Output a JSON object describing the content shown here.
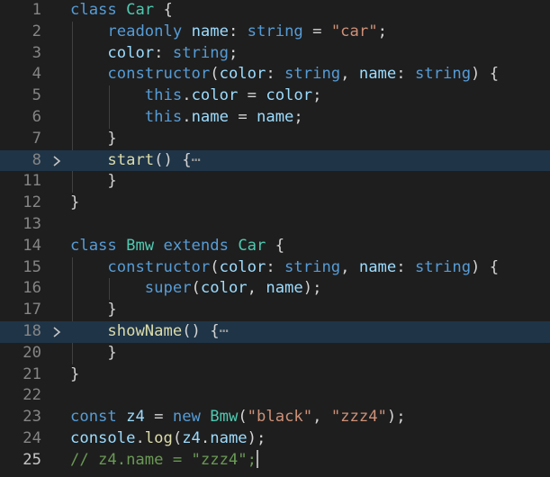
{
  "editor": {
    "colors": {
      "background": "#1e1e1e",
      "folded_line_highlight": "#1f3447",
      "line_number": "#858585",
      "active_line_number": "#c6c6c6",
      "keyword": "#569cd6",
      "function": "#dcdcaa",
      "type": "#4ec9b0",
      "variable": "#9cdcfe",
      "string": "#ce9178",
      "comment": "#6a9955",
      "plain": "#d4d4d4"
    },
    "active_line": "25",
    "fold_marker_icon": "chevron-right-icon",
    "collapsed_ellipsis": "⋯",
    "lines": [
      {
        "number": "1",
        "folded": false,
        "tokens": [
          {
            "text": "class",
            "type": "kw"
          },
          {
            "text": " ",
            "type": "pl"
          },
          {
            "text": "Car",
            "type": "ty"
          },
          {
            "text": " {",
            "type": "pl"
          }
        ]
      },
      {
        "number": "2",
        "folded": false,
        "tokens": [
          {
            "text": "    ",
            "type": "pl"
          },
          {
            "text": "readonly",
            "type": "kw"
          },
          {
            "text": " ",
            "type": "pl"
          },
          {
            "text": "name",
            "type": "var"
          },
          {
            "text": ": ",
            "type": "pl"
          },
          {
            "text": "string",
            "type": "kw"
          },
          {
            "text": " = ",
            "type": "pl"
          },
          {
            "text": "\"car\"",
            "type": "str"
          },
          {
            "text": ";",
            "type": "pl"
          }
        ]
      },
      {
        "number": "3",
        "folded": false,
        "tokens": [
          {
            "text": "    ",
            "type": "pl"
          },
          {
            "text": "color",
            "type": "var"
          },
          {
            "text": ": ",
            "type": "pl"
          },
          {
            "text": "string",
            "type": "kw"
          },
          {
            "text": ";",
            "type": "pl"
          }
        ]
      },
      {
        "number": "4",
        "folded": false,
        "tokens": [
          {
            "text": "    ",
            "type": "pl"
          },
          {
            "text": "constructor",
            "type": "kw"
          },
          {
            "text": "(",
            "type": "pl"
          },
          {
            "text": "color",
            "type": "var"
          },
          {
            "text": ": ",
            "type": "pl"
          },
          {
            "text": "string",
            "type": "kw"
          },
          {
            "text": ", ",
            "type": "pl"
          },
          {
            "text": "name",
            "type": "var"
          },
          {
            "text": ": ",
            "type": "pl"
          },
          {
            "text": "string",
            "type": "kw"
          },
          {
            "text": ") {",
            "type": "pl"
          }
        ]
      },
      {
        "number": "5",
        "folded": false,
        "tokens": [
          {
            "text": "        ",
            "type": "pl"
          },
          {
            "text": "this",
            "type": "kw"
          },
          {
            "text": ".",
            "type": "pl"
          },
          {
            "text": "color",
            "type": "var"
          },
          {
            "text": " = ",
            "type": "pl"
          },
          {
            "text": "color",
            "type": "var"
          },
          {
            "text": ";",
            "type": "pl"
          }
        ]
      },
      {
        "number": "6",
        "folded": false,
        "tokens": [
          {
            "text": "        ",
            "type": "pl"
          },
          {
            "text": "this",
            "type": "kw"
          },
          {
            "text": ".",
            "type": "pl"
          },
          {
            "text": "name",
            "type": "var"
          },
          {
            "text": " = ",
            "type": "pl"
          },
          {
            "text": "name",
            "type": "var"
          },
          {
            "text": ";",
            "type": "pl"
          }
        ]
      },
      {
        "number": "7",
        "folded": false,
        "tokens": [
          {
            "text": "    }",
            "type": "pl"
          }
        ]
      },
      {
        "number": "8",
        "folded": true,
        "tokens": [
          {
            "text": "    ",
            "type": "pl"
          },
          {
            "text": "start",
            "type": "fn"
          },
          {
            "text": "() {",
            "type": "pl"
          }
        ]
      },
      {
        "number": "11",
        "folded": false,
        "tokens": [
          {
            "text": "    }",
            "type": "pl"
          }
        ]
      },
      {
        "number": "12",
        "folded": false,
        "tokens": [
          {
            "text": "}",
            "type": "pl"
          }
        ]
      },
      {
        "number": "13",
        "folded": false,
        "tokens": []
      },
      {
        "number": "14",
        "folded": false,
        "tokens": [
          {
            "text": "class",
            "type": "kw"
          },
          {
            "text": " ",
            "type": "pl"
          },
          {
            "text": "Bmw",
            "type": "ty"
          },
          {
            "text": " ",
            "type": "pl"
          },
          {
            "text": "extends",
            "type": "kw"
          },
          {
            "text": " ",
            "type": "pl"
          },
          {
            "text": "Car",
            "type": "ty"
          },
          {
            "text": " {",
            "type": "pl"
          }
        ]
      },
      {
        "number": "15",
        "folded": false,
        "tokens": [
          {
            "text": "    ",
            "type": "pl"
          },
          {
            "text": "constructor",
            "type": "kw"
          },
          {
            "text": "(",
            "type": "pl"
          },
          {
            "text": "color",
            "type": "var"
          },
          {
            "text": ": ",
            "type": "pl"
          },
          {
            "text": "string",
            "type": "kw"
          },
          {
            "text": ", ",
            "type": "pl"
          },
          {
            "text": "name",
            "type": "var"
          },
          {
            "text": ": ",
            "type": "pl"
          },
          {
            "text": "string",
            "type": "kw"
          },
          {
            "text": ") {",
            "type": "pl"
          }
        ]
      },
      {
        "number": "16",
        "folded": false,
        "tokens": [
          {
            "text": "        ",
            "type": "pl"
          },
          {
            "text": "super",
            "type": "kw"
          },
          {
            "text": "(",
            "type": "pl"
          },
          {
            "text": "color",
            "type": "var"
          },
          {
            "text": ", ",
            "type": "pl"
          },
          {
            "text": "name",
            "type": "var"
          },
          {
            "text": ");",
            "type": "pl"
          }
        ]
      },
      {
        "number": "17",
        "folded": false,
        "tokens": [
          {
            "text": "    }",
            "type": "pl"
          }
        ]
      },
      {
        "number": "18",
        "folded": true,
        "tokens": [
          {
            "text": "    ",
            "type": "pl"
          },
          {
            "text": "showName",
            "type": "fn"
          },
          {
            "text": "() {",
            "type": "pl"
          }
        ]
      },
      {
        "number": "20",
        "folded": false,
        "tokens": [
          {
            "text": "    }",
            "type": "pl"
          }
        ]
      },
      {
        "number": "21",
        "folded": false,
        "tokens": [
          {
            "text": "}",
            "type": "pl"
          }
        ]
      },
      {
        "number": "22",
        "folded": false,
        "tokens": []
      },
      {
        "number": "23",
        "folded": false,
        "tokens": [
          {
            "text": "const",
            "type": "kw"
          },
          {
            "text": " ",
            "type": "pl"
          },
          {
            "text": "z4",
            "type": "var"
          },
          {
            "text": " = ",
            "type": "pl"
          },
          {
            "text": "new",
            "type": "kw"
          },
          {
            "text": " ",
            "type": "pl"
          },
          {
            "text": "Bmw",
            "type": "ty"
          },
          {
            "text": "(",
            "type": "pl"
          },
          {
            "text": "\"black\"",
            "type": "str"
          },
          {
            "text": ", ",
            "type": "pl"
          },
          {
            "text": "\"zzz4\"",
            "type": "str"
          },
          {
            "text": ");",
            "type": "pl"
          }
        ]
      },
      {
        "number": "24",
        "folded": false,
        "tokens": [
          {
            "text": "console",
            "type": "var"
          },
          {
            "text": ".",
            "type": "pl"
          },
          {
            "text": "log",
            "type": "fn"
          },
          {
            "text": "(",
            "type": "pl"
          },
          {
            "text": "z4",
            "type": "var"
          },
          {
            "text": ".",
            "type": "pl"
          },
          {
            "text": "name",
            "type": "var"
          },
          {
            "text": ");",
            "type": "pl"
          }
        ]
      },
      {
        "number": "25",
        "folded": false,
        "cursor_line": true,
        "tokens": [
          {
            "text": "// z4.name = \"zzz4\";",
            "type": "cm"
          }
        ]
      }
    ]
  }
}
